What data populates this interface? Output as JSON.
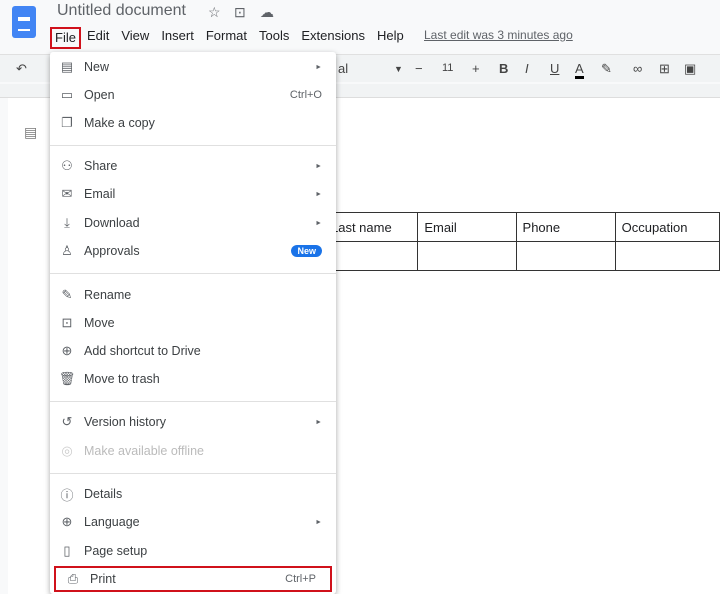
{
  "doc": {
    "title": "Untitled document",
    "last_edit": "Last edit was 3 minutes ago"
  },
  "menubar": [
    "File",
    "Edit",
    "View",
    "Insert",
    "Format",
    "Tools",
    "Extensions",
    "Help"
  ],
  "toolbar": {
    "font": "al",
    "size": "11",
    "bold": "B",
    "italic": "I",
    "underline": "U",
    "color": "A"
  },
  "table": {
    "headers": [
      "Last name",
      "Email",
      "Phone",
      "Occupation"
    ]
  },
  "file_menu": [
    {
      "icon": "document-icon",
      "label": "New",
      "right": "►"
    },
    {
      "icon": "folder-icon",
      "label": "Open",
      "right": "Ctrl+O"
    },
    {
      "icon": "copy-icon",
      "label": "Make a copy",
      "right": ""
    },
    {
      "icon": "share-icon",
      "label": "Share",
      "right": "►"
    },
    {
      "icon": "email-icon",
      "label": "Email",
      "right": "►"
    },
    {
      "icon": "download-icon",
      "label": "Download",
      "right": "►"
    },
    {
      "icon": "approvals-icon",
      "label": "Approvals",
      "badge": "New"
    },
    {
      "icon": "rename-icon",
      "label": "Rename",
      "right": ""
    },
    {
      "icon": "move-icon",
      "label": "Move",
      "right": ""
    },
    {
      "icon": "shortcut-icon",
      "label": "Add shortcut to Drive",
      "right": ""
    },
    {
      "icon": "trash-icon",
      "label": "Move to trash",
      "right": ""
    },
    {
      "icon": "history-icon",
      "label": "Version history",
      "right": "►"
    },
    {
      "icon": "offline-icon",
      "label": "Make available offline",
      "right": "",
      "disabled": true
    },
    {
      "icon": "info-icon",
      "label": "Details",
      "right": ""
    },
    {
      "icon": "globe-icon",
      "label": "Language",
      "right": "►"
    },
    {
      "icon": "page-setup-icon",
      "label": "Page setup",
      "right": ""
    },
    {
      "icon": "print-icon",
      "label": "Print",
      "right": "Ctrl+P"
    }
  ]
}
